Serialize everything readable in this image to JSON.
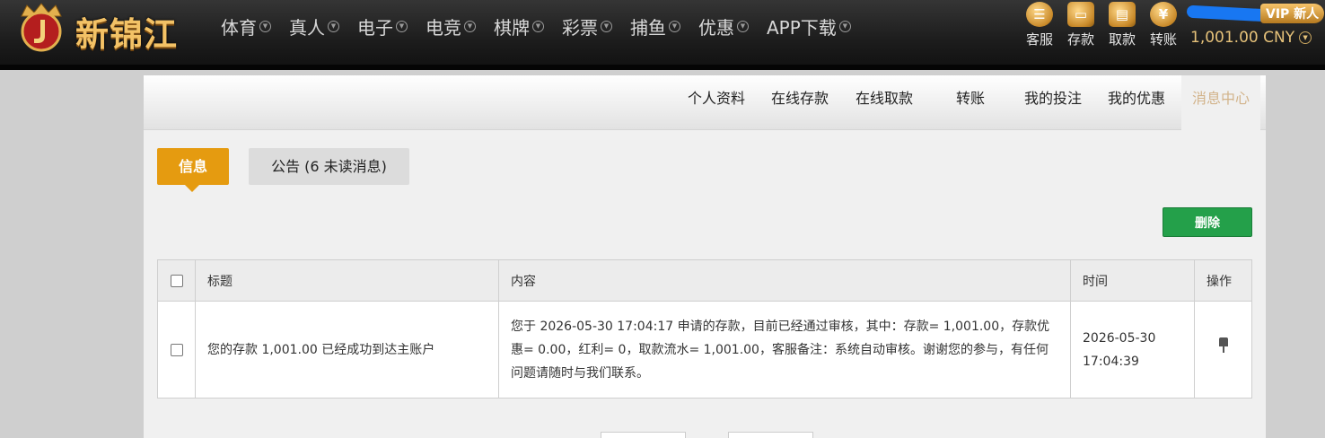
{
  "brand": {
    "name": "新锦江"
  },
  "nav": [
    {
      "label": "体育"
    },
    {
      "label": "真人"
    },
    {
      "label": "电子"
    },
    {
      "label": "电竞"
    },
    {
      "label": "棋牌"
    },
    {
      "label": "彩票"
    },
    {
      "label": "捕鱼"
    },
    {
      "label": "优惠"
    },
    {
      "label": "APP下载"
    }
  ],
  "utilities": [
    {
      "label": "客服",
      "icon": "customer-service-icon"
    },
    {
      "label": "存款",
      "icon": "deposit-wallet-icon"
    },
    {
      "label": "取款",
      "icon": "withdraw-box-icon"
    },
    {
      "label": "转账",
      "icon": "transfer-yuan-icon"
    }
  ],
  "user": {
    "vip_badge": "VIP 新人",
    "balance": "1,001.00 CNY"
  },
  "subnav": [
    {
      "label": "个人资料"
    },
    {
      "label": "在线存款"
    },
    {
      "label": "在线取款"
    },
    {
      "label": "转账"
    },
    {
      "label": "我的投注"
    },
    {
      "label": "我的优惠"
    },
    {
      "label": "消息中心",
      "active": true
    }
  ],
  "tabs": {
    "info": "信息",
    "notice": "公告 (6 未读消息)"
  },
  "actions": {
    "delete": "删除"
  },
  "table": {
    "headers": {
      "title": "标题",
      "content": "内容",
      "time": "时间",
      "action": "操作"
    },
    "rows": [
      {
        "title": "您的存款 1,001.00 已经成功到达主账户",
        "content": "您于 2026-05-30 17:04:17 申请的存款，目前已经通过审核，其中：存款= 1,001.00，存款优惠= 0.00，红利= 0，取款流水= 1,001.00，客服备注：系统自动审核。谢谢您的参与，有任何问题请随时与我们联系。",
        "time_date": "2026-05-30",
        "time_clock": "17:04:39"
      }
    ]
  },
  "colors": {
    "accent": "#e59b10",
    "delete": "#24a04a",
    "active_tab_text": "#d2b38a"
  }
}
